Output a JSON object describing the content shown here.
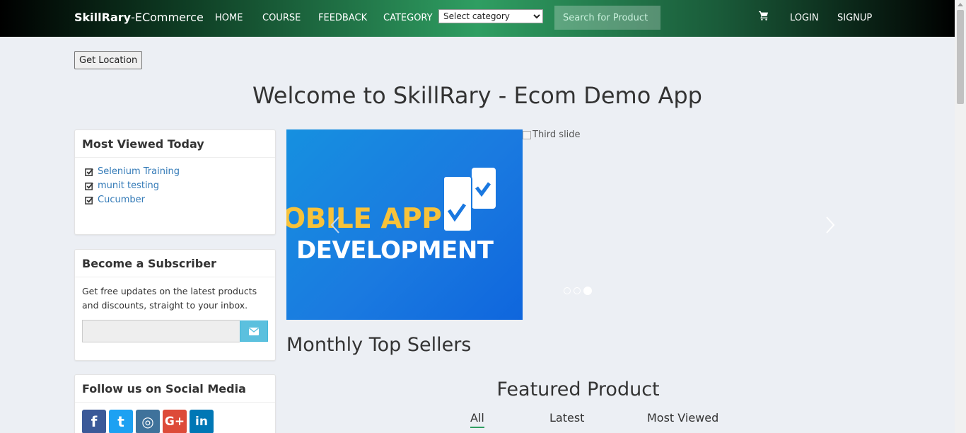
{
  "nav": {
    "brand_bold": "SkillRary",
    "brand_rest": "-ECommerce",
    "links": [
      "HOME",
      "COURSE",
      "FEEDBACK",
      "CATEGORY"
    ],
    "category_select": "Select category",
    "search_placeholder": "Search for Product",
    "cart_icon": "shopping-cart-icon",
    "login": "LOGIN",
    "signup": "SIGNUP"
  },
  "get_location": "Get Location",
  "welcome": "Welcome to SkillRary - Ecom Demo App",
  "most_viewed": {
    "title": "Most Viewed Today",
    "items": [
      "Selenium Training",
      "munit testing",
      "Cucumber"
    ]
  },
  "subscriber": {
    "title": "Become a Subscriber",
    "text": "Get free updates on the latest products and discounts, straight to your inbox."
  },
  "social": {
    "title": "Follow us on Social Media",
    "items": [
      {
        "icon": "facebook-icon",
        "color": "#3b5998",
        "glyph": "f"
      },
      {
        "icon": "twitter-icon",
        "color": "#1da1f2",
        "glyph": "t"
      },
      {
        "icon": "instagram-icon",
        "color": "#3f729b",
        "glyph": "◎"
      },
      {
        "icon": "google-plus-icon",
        "color": "#dd4b39",
        "glyph": "G+"
      },
      {
        "icon": "linkedin-icon",
        "color": "#0077b5",
        "glyph": "in"
      }
    ]
  },
  "carousel": {
    "slide_line1": "OBILE APP",
    "slide_line2": "DEVELOPMENT",
    "broken_alt": "Third slide",
    "active_index": 3,
    "total": 3
  },
  "monthly_title": "Monthly Top Sellers",
  "featured_title": "Featured Product",
  "tabs": [
    "All",
    "Latest",
    "Most Viewed"
  ],
  "colors": {
    "accent": "#2f9e62",
    "link": "#337ab7",
    "subscribe_button": "#5bc0de"
  }
}
